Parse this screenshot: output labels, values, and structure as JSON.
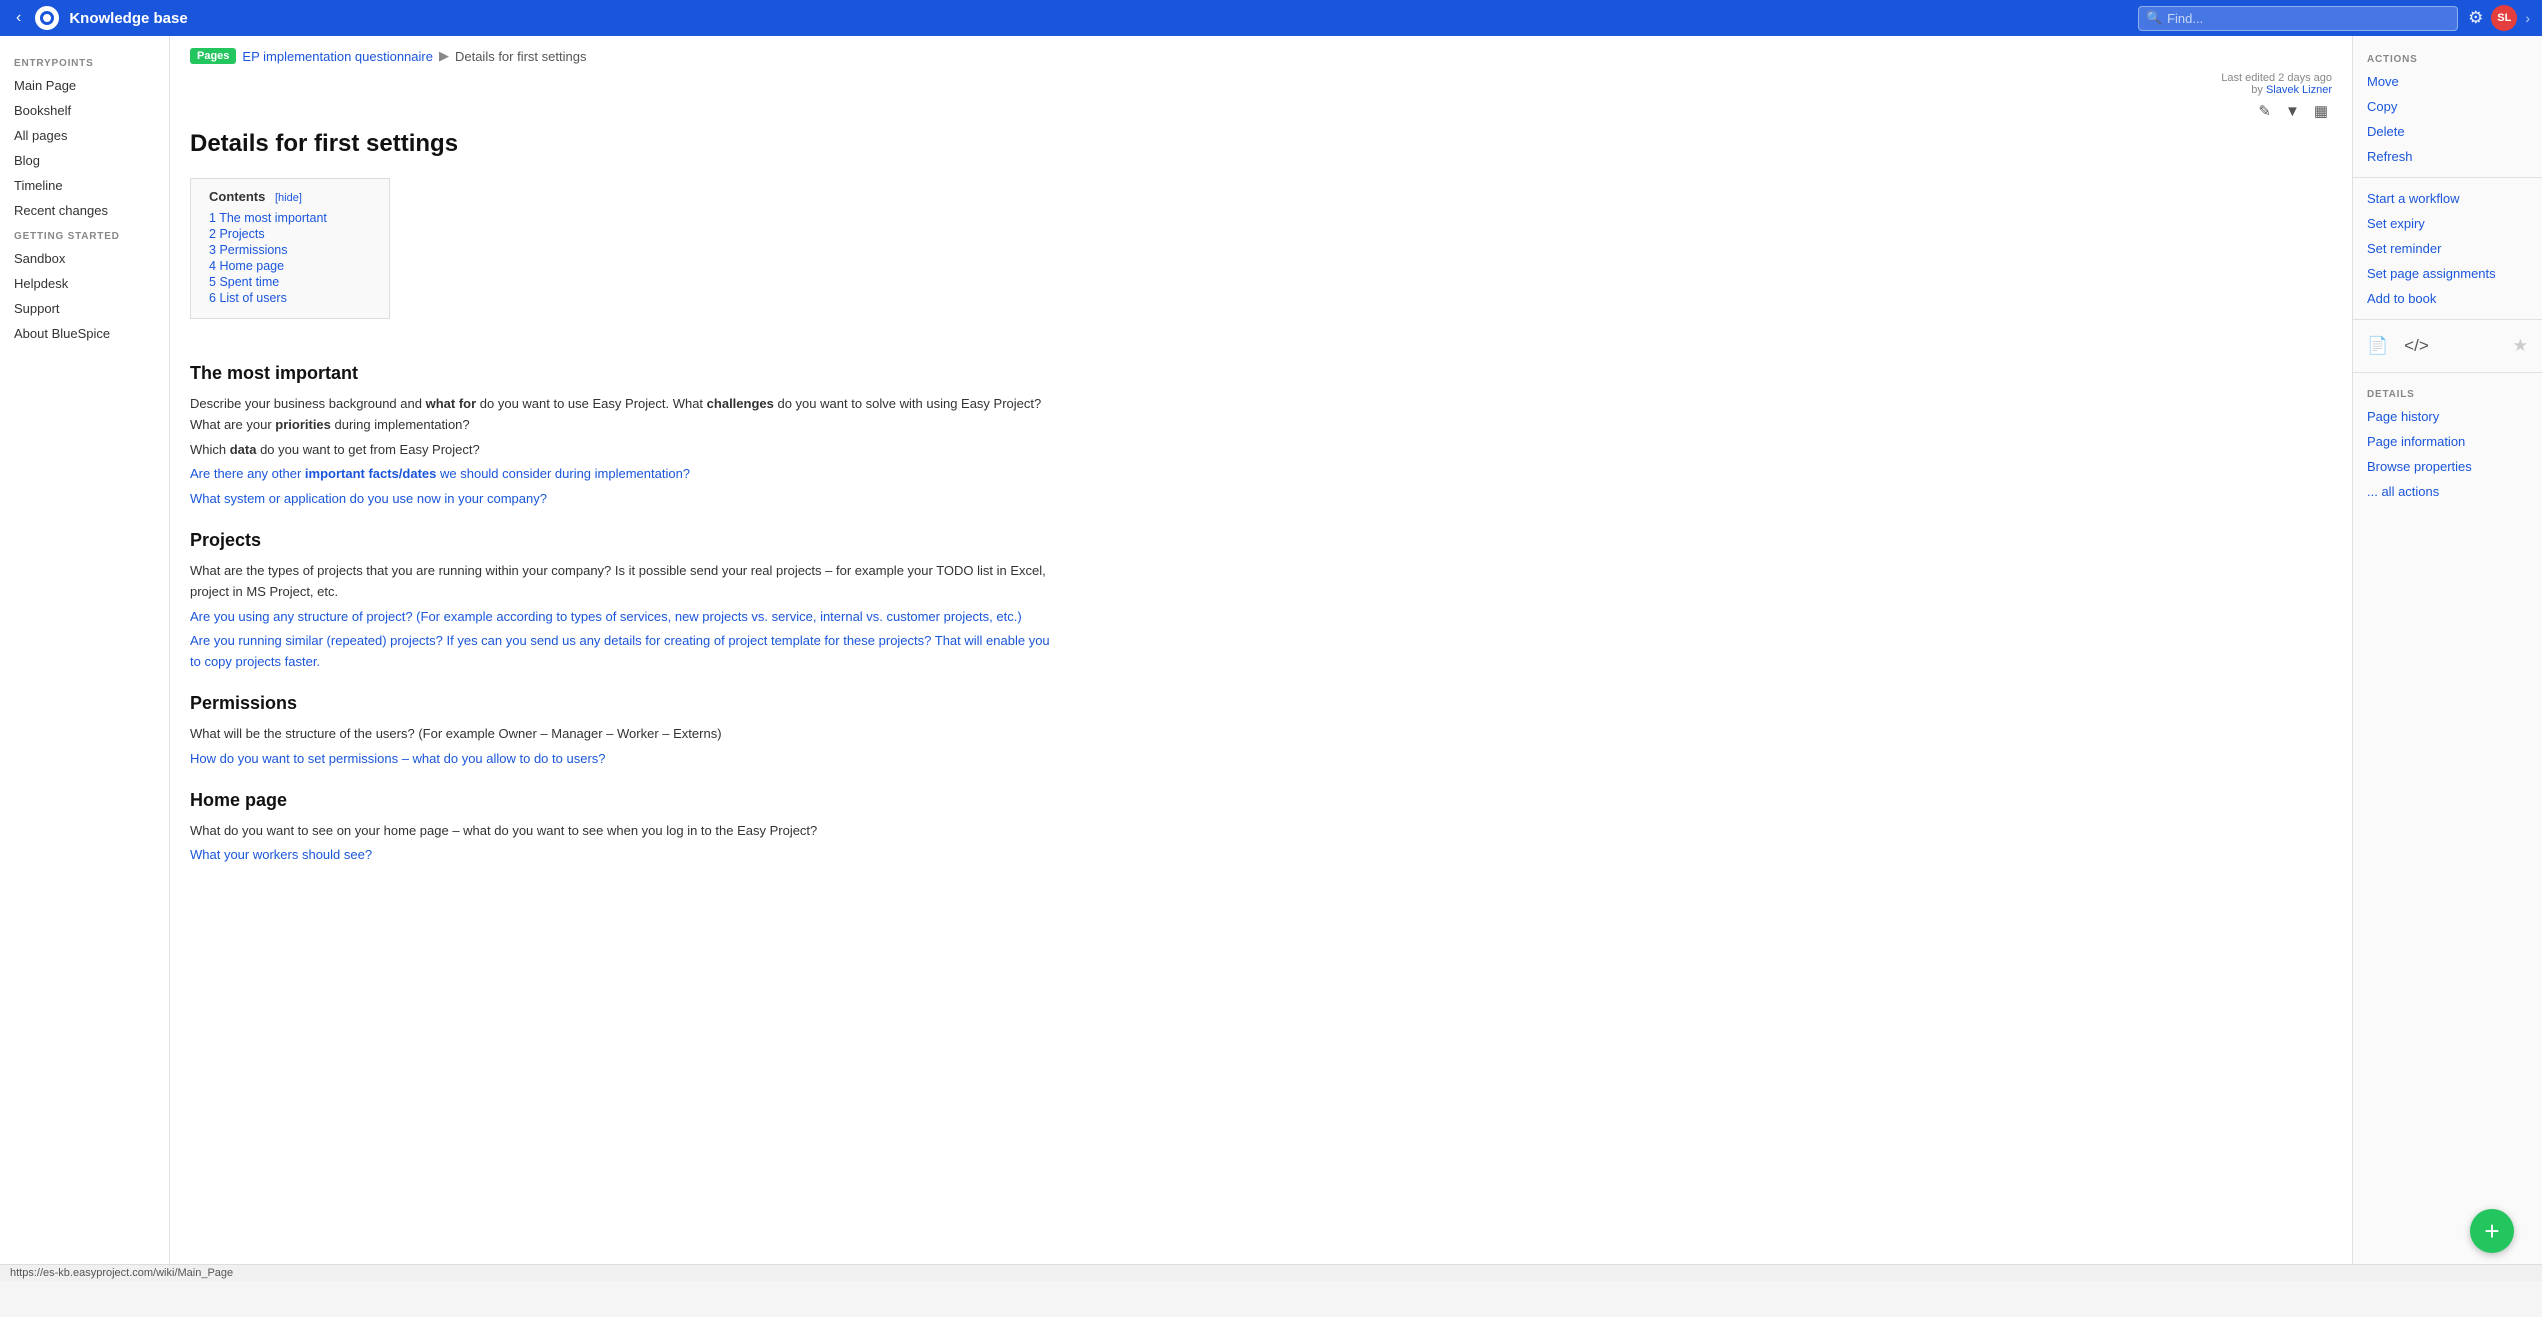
{
  "nav": {
    "title": "Knowledge base",
    "search_placeholder": "Find...",
    "back_label": "‹",
    "chevron": "›",
    "settings_icon": "⚙",
    "avatar_initials": "SL"
  },
  "sidebar": {
    "entrypoints_label": "ENTRYPOINTS",
    "items_entry": [
      {
        "label": "Main Page"
      },
      {
        "label": "Bookshelf"
      },
      {
        "label": "All pages"
      },
      {
        "label": "Blog"
      },
      {
        "label": "Timeline"
      },
      {
        "label": "Recent changes"
      }
    ],
    "getting_started_label": "GETTING STARTED",
    "items_started": [
      {
        "label": "Sandbox"
      },
      {
        "label": "Helpdesk"
      },
      {
        "label": "Support"
      },
      {
        "label": "About BlueSpice"
      }
    ]
  },
  "breadcrumb": {
    "pages_badge": "Pages",
    "parent_link": "EP implementation questionnaire",
    "separator": "▶",
    "current": "Details for first settings"
  },
  "page": {
    "meta_edited": "Last edited 2 days ago",
    "meta_by": "by",
    "meta_author": "Slavek Lizner",
    "title": "Details for first settings"
  },
  "toc": {
    "title": "Contents",
    "hide_label": "[hide]",
    "items": [
      {
        "num": "1",
        "label": "The most important"
      },
      {
        "num": "2",
        "label": "Projects"
      },
      {
        "num": "3",
        "label": "Permissions"
      },
      {
        "num": "4",
        "label": "Home page"
      },
      {
        "num": "5",
        "label": "Spent time"
      },
      {
        "num": "6",
        "label": "List of users"
      }
    ]
  },
  "sections": [
    {
      "id": "most-important",
      "heading": "The most important",
      "paragraphs": [
        "Describe your business background and <b>what for</b> do you want to use Easy Project. What <b>challenges</b> do you want to solve with using Easy Project? What are your <b>priorities</b> during implementation?",
        "Which <b>data</b> do you want to get from Easy Project?",
        "Are there any other <b>important facts/dates</b> we should consider during implementation?",
        "What system or application do you use now in your company?"
      ]
    },
    {
      "id": "projects",
      "heading": "Projects",
      "paragraphs": [
        "What are the types of projects that you are running within your company? Is it possible send your real projects – for example your TODO list in Excel, project in MS Project, etc.",
        "Are you using any structure of project? (For example according to types of services, new projects vs. service, internal vs. customer projects, etc.)",
        "Are you running similar (repeated) projects? If yes can you send us any details for creating of project template for these projects? That will enable you to copy projects faster."
      ]
    },
    {
      "id": "permissions",
      "heading": "Permissions",
      "paragraphs": [
        "What will be the structure of the users? (For example Owner – Manager – Worker – Externs)",
        "How do you want to set permissions – what do you allow to do to users?"
      ]
    },
    {
      "id": "home-page",
      "heading": "Home page",
      "paragraphs": [
        "What do you want to see on your home page – what do you want to see when you log in to the Easy Project?",
        "What your workers should see?"
      ]
    }
  ],
  "right_panel": {
    "actions_label": "ACTIONS",
    "actions": [
      {
        "label": "Move"
      },
      {
        "label": "Copy"
      },
      {
        "label": "Delete"
      },
      {
        "label": "Refresh"
      }
    ],
    "workflow_actions": [
      {
        "label": "Start a workflow"
      },
      {
        "label": "Set expiry"
      },
      {
        "label": "Set reminder"
      },
      {
        "label": "Set page assignments"
      },
      {
        "label": "Add to book"
      }
    ],
    "details_label": "DETAILS",
    "details": [
      {
        "label": "Page history"
      },
      {
        "label": "Page information"
      },
      {
        "label": "Browse properties"
      },
      {
        "label": "... all actions"
      }
    ]
  },
  "fab": {
    "label": "+"
  },
  "status_bar": {
    "url": "https://es-kb.easyproject.com/wiki/Main_Page"
  }
}
